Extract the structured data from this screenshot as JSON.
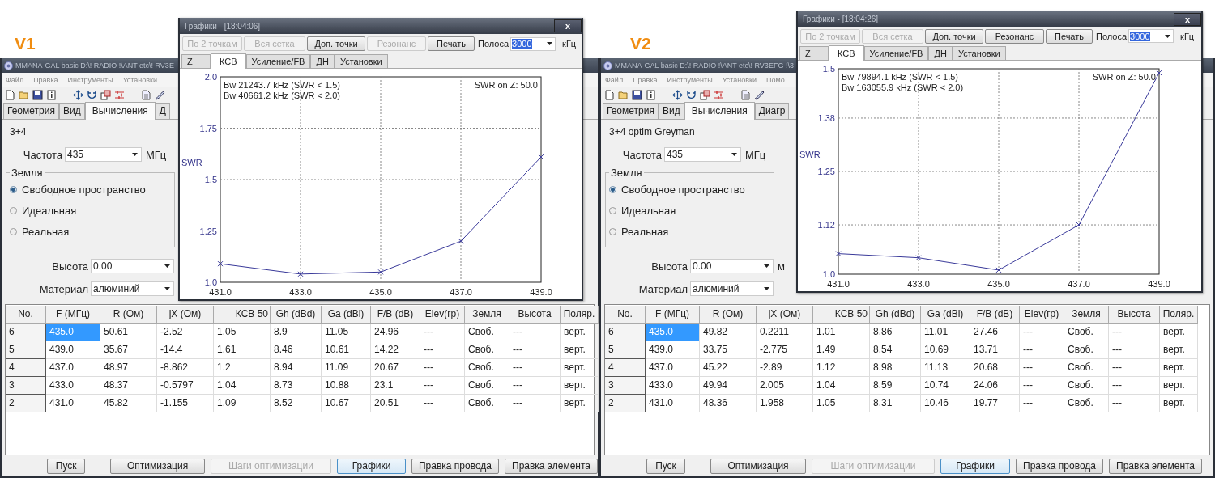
{
  "panels": [
    {
      "label": "V1",
      "main_window": {
        "title": "MMANA-GAL basic D:\\! RADIO !\\ANT etc\\! RV3E",
        "menu": [
          "Файл",
          "Правка",
          "Инструменты",
          "Установки"
        ],
        "tabs": [
          {
            "label": "Геометрия",
            "selected": false
          },
          {
            "label": "Вид",
            "selected": false
          },
          {
            "label": "Вычисления",
            "selected": true
          },
          {
            "label": "Д",
            "selected": false
          }
        ],
        "model_name": "3+4",
        "frequency": {
          "label": "Частота",
          "value": "435",
          "unit": "МГц"
        },
        "ground": {
          "title": "Земля",
          "options": [
            {
              "label": "Свободное пространство",
              "selected": true
            },
            {
              "label": "Идеальная",
              "selected": false
            },
            {
              "label": "Реальная",
              "selected": false
            }
          ]
        },
        "height": {
          "label": "Высота",
          "value": "0.00"
        },
        "material": {
          "label": "Материал",
          "value": "алюминий"
        },
        "table": {
          "columns": [
            "No.",
            "F (МГц)",
            "R (Ом)",
            "jX (Ом)",
            "КСВ 50",
            "Gh (dBd)",
            "Ga (dBi)",
            "F/B (dB)",
            "Elev(гр)",
            "Земля",
            "Высота",
            "Поляр."
          ],
          "rows": [
            {
              "selected": true,
              "cells": [
                "6",
                "435.0",
                "50.61",
                "-2.52",
                "1.05",
                "8.9",
                "11.05",
                "24.96",
                "---",
                "Своб.",
                "---",
                "верт."
              ]
            },
            {
              "selected": false,
              "cells": [
                "5",
                "439.0",
                "35.67",
                "-14.4",
                "1.61",
                "8.46",
                "10.61",
                "14.22",
                "---",
                "Своб.",
                "---",
                "верт."
              ]
            },
            {
              "selected": false,
              "cells": [
                "4",
                "437.0",
                "48.97",
                "-8.862",
                "1.2",
                "8.94",
                "11.09",
                "20.67",
                "---",
                "Своб.",
                "---",
                "верт."
              ]
            },
            {
              "selected": false,
              "cells": [
                "3",
                "433.0",
                "48.37",
                "-0.5797",
                "1.04",
                "8.73",
                "10.88",
                "23.1",
                "---",
                "Своб.",
                "---",
                "верт."
              ]
            },
            {
              "selected": false,
              "cells": [
                "2",
                "431.0",
                "45.82",
                "-1.155",
                "1.09",
                "8.52",
                "10.67",
                "20.51",
                "---",
                "Своб.",
                "---",
                "верт."
              ]
            }
          ]
        },
        "buttons": [
          {
            "label": "Пуск",
            "disabled": false,
            "focused": false
          },
          {
            "label": "Оптимизация",
            "disabled": false,
            "focused": false
          },
          {
            "label": "Шаги оптимизации",
            "disabled": true,
            "focused": false
          },
          {
            "label": "Графики",
            "disabled": false,
            "focused": true
          },
          {
            "label": "Правка провода",
            "disabled": false,
            "focused": false
          },
          {
            "label": "Правка элемента",
            "disabled": false,
            "focused": false
          }
        ]
      },
      "chart_window": {
        "title": "Графики - [18:04:06]",
        "close": "x",
        "buttons": [
          {
            "label": "По 2 точкам",
            "disabled": true
          },
          {
            "label": "Вся сетка",
            "disabled": true
          },
          {
            "label": "Доп. точки",
            "disabled": false
          },
          {
            "label": "Резонанс",
            "disabled": true
          },
          {
            "label": "Печать",
            "disabled": false
          }
        ],
        "band": {
          "label": "Полоса",
          "value": "3000",
          "unit": "кГц"
        },
        "tabs": [
          {
            "label": "Z",
            "selected": false
          },
          {
            "label": "КСВ",
            "selected": true
          },
          {
            "label": "Усиление/FB",
            "selected": false
          },
          {
            "label": "ДН",
            "selected": false
          },
          {
            "label": "Установки",
            "selected": false
          }
        ],
        "chart_data": {
          "type": "line",
          "ylabel": "SWR",
          "categories": [
            "431.0",
            "433.0",
            "435.0",
            "437.0",
            "439.0"
          ],
          "series": [
            {
              "color": "#3a3a9a",
              "marker": "x",
              "values": [
                1.09,
                1.04,
                1.05,
                1.2,
                1.61
              ]
            }
          ],
          "grid": true,
          "ylim": [
            1.0,
            2.0
          ],
          "yticks": [
            {
              "value": 1.0,
              "label": "1.0"
            },
            {
              "value": 1.25,
              "label": "1.25"
            },
            {
              "value": 1.5,
              "label": "1.5"
            },
            {
              "value": 1.75,
              "label": "1.75"
            },
            {
              "value": 2.0,
              "label": "2.0"
            }
          ],
          "annotations": [
            {
              "text": "Bw 21243.7 kHz (SWR < 1.5)"
            },
            {
              "text": "Bw 40661.2 kHz (SWR < 2.0)"
            },
            {
              "text": "SWR on Z: 50.0"
            }
          ]
        }
      }
    },
    {
      "label": "V2",
      "main_window": {
        "title": "MMANA-GAL basic D:\\! RADIO !\\ANT etc\\! RV3EFG !\\3",
        "menu": [
          "Файл",
          "Правка",
          "Инструменты",
          "Установки",
          "Помо"
        ],
        "tabs": [
          {
            "label": "Геометрия",
            "selected": false
          },
          {
            "label": "Вид",
            "selected": false
          },
          {
            "label": "Вычисления",
            "selected": true
          },
          {
            "label": "Диагр",
            "selected": false
          }
        ],
        "model_name": "3+4 optim Greyman",
        "frequency": {
          "label": "Частота",
          "value": "435",
          "unit": "МГц"
        },
        "ground": {
          "title": "Земля",
          "options": [
            {
              "label": "Свободное пространство",
              "selected": true
            },
            {
              "label": "Идеальная",
              "selected": false
            },
            {
              "label": "Реальная",
              "selected": false
            }
          ]
        },
        "height": {
          "label": "Высота",
          "value": "0.00",
          "unit": "м"
        },
        "material": {
          "label": "Материал",
          "value": "алюминий"
        },
        "table": {
          "columns": [
            "No.",
            "F (МГц)",
            "R (Ом)",
            "jX (Ом)",
            "КСВ 50",
            "Gh (dBd)",
            "Ga (dBi)",
            "F/B (dB)",
            "Elev(гр)",
            "Земля",
            "Высота",
            "Поляр."
          ],
          "rows": [
            {
              "selected": true,
              "cells": [
                "6",
                "435.0",
                "49.82",
                "0.2211",
                "1.01",
                "8.86",
                "11.01",
                "27.46",
                "---",
                "Своб.",
                "---",
                "верт."
              ]
            },
            {
              "selected": false,
              "cells": [
                "5",
                "439.0",
                "33.75",
                "-2.775",
                "1.49",
                "8.54",
                "10.69",
                "13.71",
                "---",
                "Своб.",
                "---",
                "верт."
              ]
            },
            {
              "selected": false,
              "cells": [
                "4",
                "437.0",
                "45.22",
                "-2.89",
                "1.12",
                "8.98",
                "11.13",
                "20.68",
                "---",
                "Своб.",
                "---",
                "верт."
              ]
            },
            {
              "selected": false,
              "cells": [
                "3",
                "433.0",
                "49.94",
                "2.005",
                "1.04",
                "8.59",
                "10.74",
                "24.06",
                "---",
                "Своб.",
                "---",
                "верт."
              ]
            },
            {
              "selected": false,
              "cells": [
                "2",
                "431.0",
                "48.36",
                "1.958",
                "1.05",
                "8.31",
                "10.46",
                "19.77",
                "---",
                "Своб.",
                "---",
                "верт."
              ]
            }
          ]
        },
        "buttons": [
          {
            "label": "Пуск",
            "disabled": false,
            "focused": false
          },
          {
            "label": "Оптимизация",
            "disabled": false,
            "focused": false
          },
          {
            "label": "Шаги оптимизации",
            "disabled": true,
            "focused": false
          },
          {
            "label": "Графики",
            "disabled": false,
            "focused": true
          },
          {
            "label": "Правка провода",
            "disabled": false,
            "focused": false
          },
          {
            "label": "Правка элемента",
            "disabled": false,
            "focused": false
          }
        ]
      },
      "chart_window": {
        "title": "Графики - [18:04:26]",
        "close": "x",
        "buttons": [
          {
            "label": "По 2 точкам",
            "disabled": true
          },
          {
            "label": "Вся сетка",
            "disabled": true
          },
          {
            "label": "Доп. точки",
            "disabled": false
          },
          {
            "label": "Резонанс",
            "disabled": false
          },
          {
            "label": "Печать",
            "disabled": false
          }
        ],
        "band": {
          "label": "Полоса",
          "value": "3000",
          "unit": "кГц"
        },
        "tabs": [
          {
            "label": "Z",
            "selected": false
          },
          {
            "label": "КСВ",
            "selected": true
          },
          {
            "label": "Усиление/FB",
            "selected": false
          },
          {
            "label": "ДН",
            "selected": false
          },
          {
            "label": "Установки",
            "selected": false
          }
        ],
        "chart_data": {
          "type": "line",
          "ylabel": "SWR",
          "categories": [
            "431.0",
            "433.0",
            "435.0",
            "437.0",
            "439.0"
          ],
          "series": [
            {
              "color": "#3a3a9a",
              "marker": "x",
              "values": [
                1.05,
                1.04,
                1.01,
                1.12,
                1.49
              ]
            }
          ],
          "grid": true,
          "ylim": [
            1.0,
            1.5
          ],
          "yticks": [
            {
              "value": 1.0,
              "label": "1.0"
            },
            {
              "value": 1.12,
              "label": "1.12"
            },
            {
              "value": 1.25,
              "label": "1.25"
            },
            {
              "value": 1.38,
              "label": "1.38"
            },
            {
              "value": 1.5,
              "label": "1.5"
            }
          ],
          "annotations": [
            {
              "text": "Bw 79894.1 kHz (SWR < 1.5)"
            },
            {
              "text": "Bw 163055.9 kHz (SWR < 2.0)"
            },
            {
              "text": "SWR on Z: 50.0"
            }
          ]
        }
      }
    }
  ]
}
